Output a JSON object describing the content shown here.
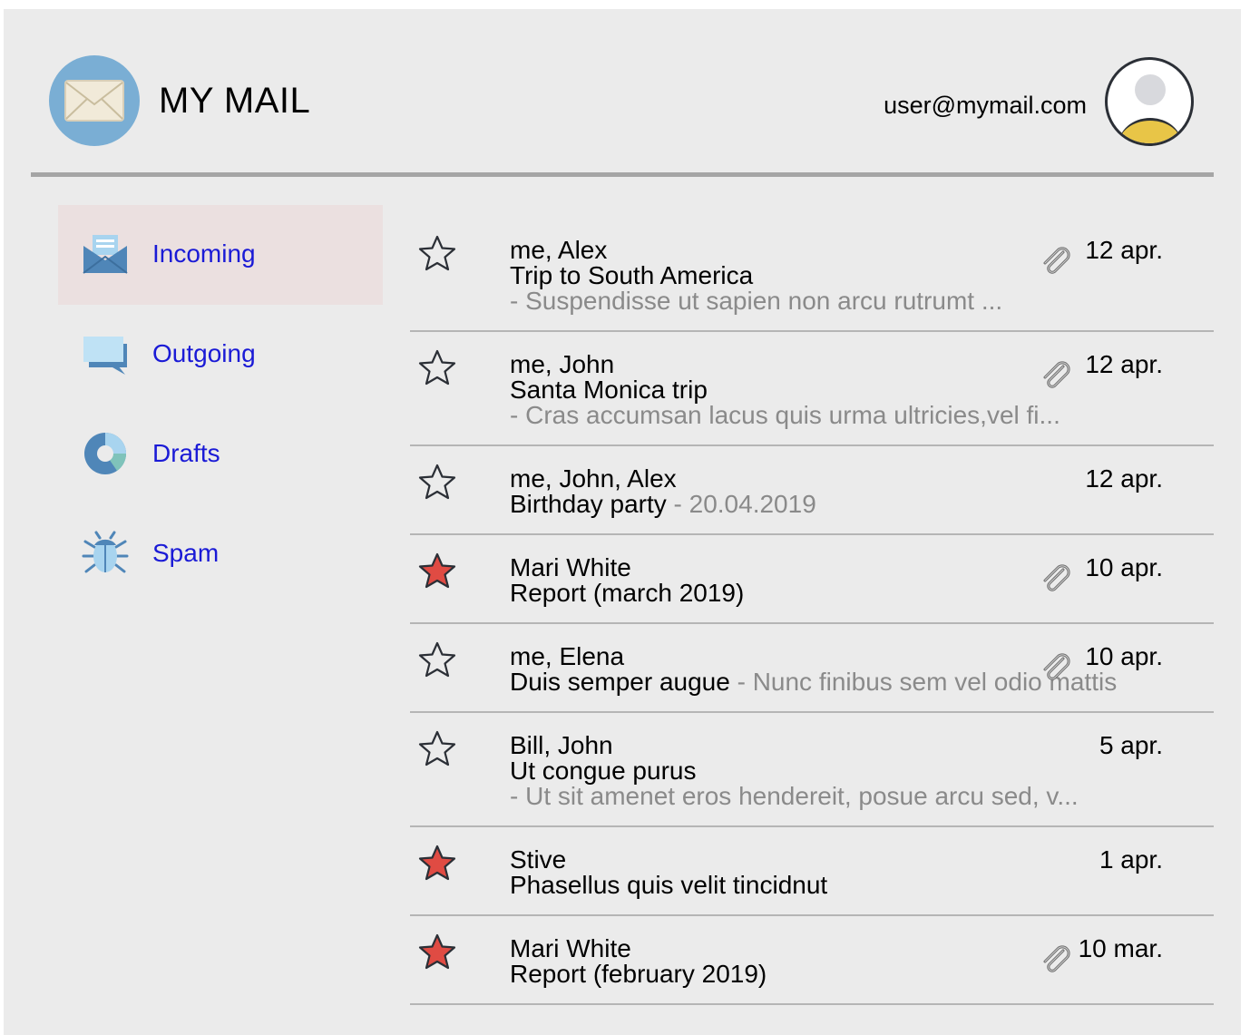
{
  "header": {
    "title": "MY MAIL",
    "user_email": "user@mymail.com"
  },
  "sidebar": {
    "items": [
      {
        "label": "Incoming",
        "icon": "inbox-envelope-icon",
        "active": true
      },
      {
        "label": "Outgoing",
        "icon": "speech-bubble-icon",
        "active": false
      },
      {
        "label": "Drafts",
        "icon": "pie-chart-icon",
        "active": false
      },
      {
        "label": "Spam",
        "icon": "bug-icon",
        "active": false
      }
    ]
  },
  "mails": [
    {
      "senders": "me, Alex",
      "subject": "Trip to South America",
      "subject_snippet": "",
      "snippet": "- Suspendisse ut sapien non arcu rutrumt ...",
      "date": "12 apr.",
      "starred": false,
      "attachment": true
    },
    {
      "senders": "me, John",
      "subject": "Santa Monica trip",
      "subject_snippet": "",
      "snippet": "- Cras accumsan lacus quis urma ultricies,vel fi...",
      "date": "12 apr.",
      "starred": false,
      "attachment": true
    },
    {
      "senders": "me, John, Alex",
      "subject": "Birthday party",
      "subject_snippet": " - 20.04.2019",
      "snippet": "",
      "date": "12 apr.",
      "starred": false,
      "attachment": false
    },
    {
      "senders": "Mari White",
      "subject": "Report (march 2019)",
      "subject_snippet": "",
      "snippet": "",
      "date": "10 apr.",
      "starred": true,
      "attachment": true
    },
    {
      "senders": "me, Elena",
      "subject": "Duis semper augue",
      "subject_snippet": " - Nunc finibus sem vel odio mattis",
      "snippet": "",
      "date": "10 apr.",
      "starred": false,
      "attachment": true
    },
    {
      "senders": "Bill, John",
      "subject": "Ut congue purus",
      "subject_snippet": "",
      "snippet": "- Ut sit amenet eros hendereit, posue arcu sed, v...",
      "date": "5 apr.",
      "starred": false,
      "attachment": false
    },
    {
      "senders": "Stive",
      "subject": "Phasellus quis velit tincidnut",
      "subject_snippet": "",
      "snippet": "",
      "date": "1 apr.",
      "starred": true,
      "attachment": false
    },
    {
      "senders": "Mari White",
      "subject": "Report (february 2019)",
      "subject_snippet": "",
      "snippet": "",
      "date": "10 mar.",
      "starred": true,
      "attachment": true
    }
  ],
  "colors": {
    "background": "#ebebeb",
    "link": "#1a1ad6",
    "active_nav": "#ebe0e0",
    "star_filled": "#e04b43",
    "snippet_text": "#8a8a8a",
    "divider": "#b5b5b5"
  }
}
